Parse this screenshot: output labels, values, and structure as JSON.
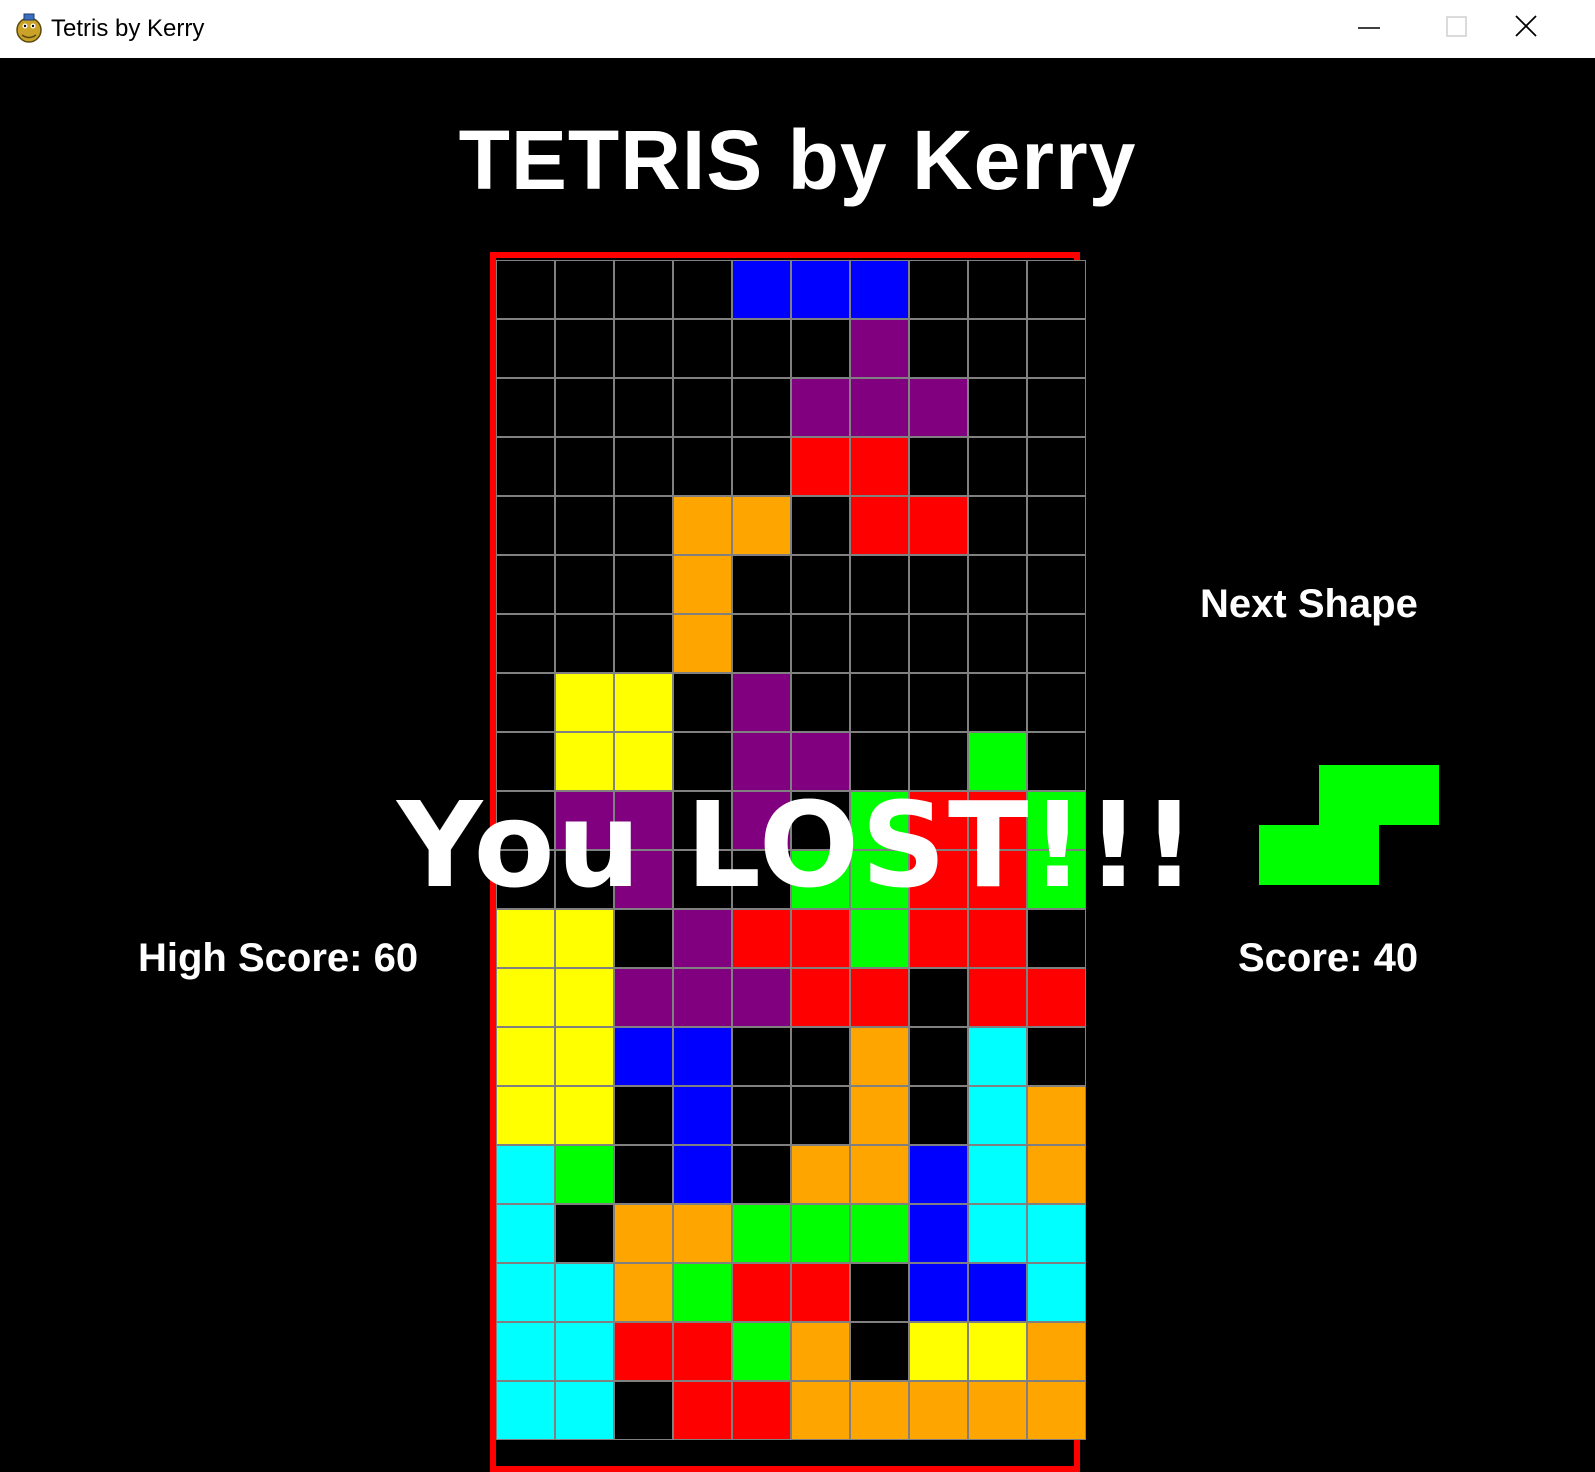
{
  "window": {
    "title": "Tetris by Kerry",
    "icon": "pygame-snake-icon"
  },
  "game": {
    "heading": "TETRIS by Kerry",
    "next_shape_label": "Next Shape",
    "high_score_text": "High Score: 60",
    "score_text": "Score: 40",
    "game_over_text": "You LOST!!!",
    "colors": {
      "border": "#ff0000",
      "grid_line": "#808080",
      "background": "#000000",
      "B": "#0000ff",
      "P": "#800080",
      "R": "#ff0000",
      "O": "#ffa500",
      "Y": "#ffff00",
      "G": "#00ff00",
      "C": "#00ffff",
      ".": "#000000"
    },
    "board": [
      "....BBB...",
      "......P...",
      ".....PPP..",
      ".....RR...",
      "...OO.RR..",
      "...O......",
      "...O......",
      ".YY.P.....",
      ".YY.PP..G.",
      ".PP.P.GRRG",
      "..P..GGRRG",
      "YY.PRRGRR.",
      "YYPPPRR.RR",
      "YYBB..O.C.",
      "YY.B..O.CO",
      "CG.B.OOBCO",
      "C.OOGGGBCC",
      "CCOGRR.BBC",
      "CCRRGO.YYO",
      "CC.RROOOOO"
    ],
    "next_shape": {
      "color": "#00ff00",
      "rows": [
        ".GG",
        "GG."
      ]
    }
  }
}
